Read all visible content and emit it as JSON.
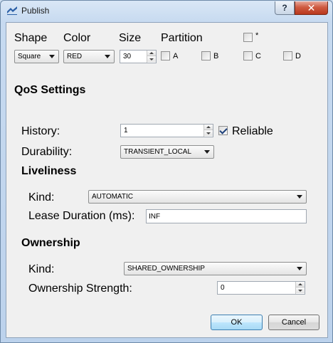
{
  "window": {
    "title": "Publish",
    "help_label": "?",
    "close_label": "✕",
    "icon": "app-icon"
  },
  "header": {
    "shape_label": "Shape",
    "color_label": "Color",
    "size_label": "Size",
    "partition_label": "Partition"
  },
  "shape": {
    "selected": "Square"
  },
  "color": {
    "selected": "RED"
  },
  "size": {
    "value": "30"
  },
  "partition": {
    "options": [
      {
        "label": "*",
        "checked": false
      },
      {
        "label": "A",
        "checked": false
      },
      {
        "label": "B",
        "checked": false
      },
      {
        "label": "C",
        "checked": false
      },
      {
        "label": "D",
        "checked": false
      }
    ]
  },
  "qos": {
    "title": "QoS Settings",
    "history_label": "History:",
    "history_value": "1",
    "reliable_label": "Reliable",
    "reliable_checked": true,
    "durability_label": "Durability:",
    "durability_value": "TRANSIENT_LOCAL"
  },
  "liveliness": {
    "title": "Liveliness",
    "kind_label": "Kind:",
    "kind_value": "AUTOMATIC",
    "lease_label": "Lease Duration (ms):",
    "lease_value": "INF"
  },
  "ownership": {
    "title": "Ownership",
    "kind_label": "Kind:",
    "kind_value": "SHARED_OWNERSHIP",
    "strength_label": "Ownership Strength:",
    "strength_value": "0"
  },
  "buttons": {
    "ok": "OK",
    "cancel": "Cancel"
  }
}
